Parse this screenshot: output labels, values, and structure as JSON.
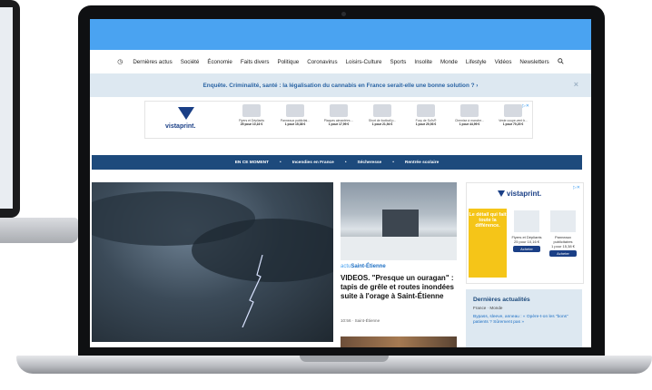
{
  "site": {
    "brand_color": "#4aa3f1",
    "nav": {
      "items": [
        "Dernières actus",
        "Société",
        "Économie",
        "Faits divers",
        "Politique",
        "Coronavirus",
        "Loisirs-Culture",
        "Sports",
        "Insolite",
        "Monde",
        "Lifestyle",
        "Vidéos",
        "Newsletters"
      ],
      "icons": {
        "clock": "clock-icon",
        "search": "search-icon"
      }
    },
    "banner": {
      "text": "Enquête. Criminalité, santé : la légalisation du cannabis en France serait-elle une bonne solution ? ›",
      "close": "×"
    },
    "top_ad": {
      "brand": "vistaprint.",
      "products": [
        {
          "name": "Flyers et Dépliants",
          "price": "25 pour 10,16 €"
        },
        {
          "name": "Panneaux publicitai...",
          "price": "1 pour 15,38 €"
        },
        {
          "name": "Plaques aimantées ...",
          "price": "1 pour 17,99 €"
        },
        {
          "name": "Short de football p...",
          "price": "1 pour 21,94 €"
        },
        {
          "name": "Foxy de Sol's®",
          "price": "1 pour 20,93 €"
        },
        {
          "name": "Chemise à manche...",
          "price": "1 pour 44,99 €"
        },
        {
          "name": "Veste coupe-vent b...",
          "price": "1 pour 70,20 €"
        }
      ]
    },
    "trending": {
      "items": [
        "EN CE MOMENT",
        "Incendies en France",
        "Sécheresse",
        "Rentrée scolaire"
      ],
      "sep": "•"
    },
    "article": {
      "source_prefix": "actu",
      "source_city": "Saint-Étienne",
      "headline": "VIDEOS. \"Presque un ouragan\" : tapis de grêle et routes inondées suite à l'orage à Saint-Étienne",
      "meta": "10:56 · Saint-Étienne"
    },
    "side_ad": {
      "brand": "vistaprint.",
      "promo": "Le détail qui fait toute la différence.",
      "products": [
        {
          "name": "Flyers et Dépliants",
          "price": "25 pour 10,16 €",
          "cta": "Acheter"
        },
        {
          "name": "Panneaux publicitaires",
          "price": "1 pour 15,38 €",
          "cta": "Acheter"
        }
      ]
    },
    "latest": {
      "heading": "Dernières actualités",
      "subtitle": "France · Monde",
      "item": "Bypass, sleeve, anneau : « Opère-t-on les \"bons\" patients ? Sûrement pas »"
    }
  }
}
